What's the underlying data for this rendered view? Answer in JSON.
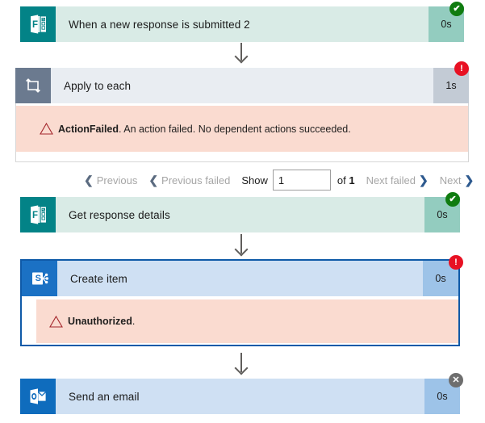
{
  "flow": {
    "steps": [
      {
        "id": "trigger",
        "name": "When a new response is submitted 2",
        "duration": "0s",
        "icon": "microsoft-forms-icon",
        "status": "succeeded",
        "status_glyph": "✔"
      },
      {
        "id": "apply-to-each",
        "name": "Apply to each",
        "duration": "1s",
        "icon": "loop-repeat-icon",
        "status": "failed",
        "status_glyph": "!"
      },
      {
        "id": "get-response-details",
        "name": "Get response details",
        "duration": "0s",
        "icon": "microsoft-forms-icon",
        "status": "succeeded",
        "status_glyph": "✔"
      },
      {
        "id": "create-item",
        "name": "Create item",
        "duration": "0s",
        "icon": "sharepoint-icon",
        "status": "failed",
        "status_glyph": "!"
      },
      {
        "id": "send-an-email",
        "name": "Send an email",
        "duration": "0s",
        "icon": "outlook-icon",
        "status": "skipped",
        "status_glyph": "✕"
      }
    ],
    "errors": {
      "action_failed": {
        "code": "ActionFailed",
        "message": ". An action failed. No dependent actions succeeded."
      },
      "unauthorized": {
        "code": "Unauthorized",
        "message": "."
      }
    },
    "pager": {
      "previous_label": "Previous",
      "previous_failed_label": "Previous failed",
      "show_label": "Show",
      "page_value": "1",
      "of_label": "of",
      "total_pages": "1",
      "next_failed_label": "Next failed",
      "next_label": "Next",
      "chevron_left": "❮",
      "chevron_right": "❯"
    }
  },
  "colors": {
    "success": "#107c10",
    "error": "#e81123",
    "skipped": "#6e6e6e",
    "error_banner_bg": "#fadbd0",
    "forms_accent": "#038387",
    "sharepoint_accent": "#1b71c4",
    "outlook_accent": "#0f6cbd",
    "loop_accent": "#6b7a8f",
    "selection_outline": "#0f5aa8"
  }
}
